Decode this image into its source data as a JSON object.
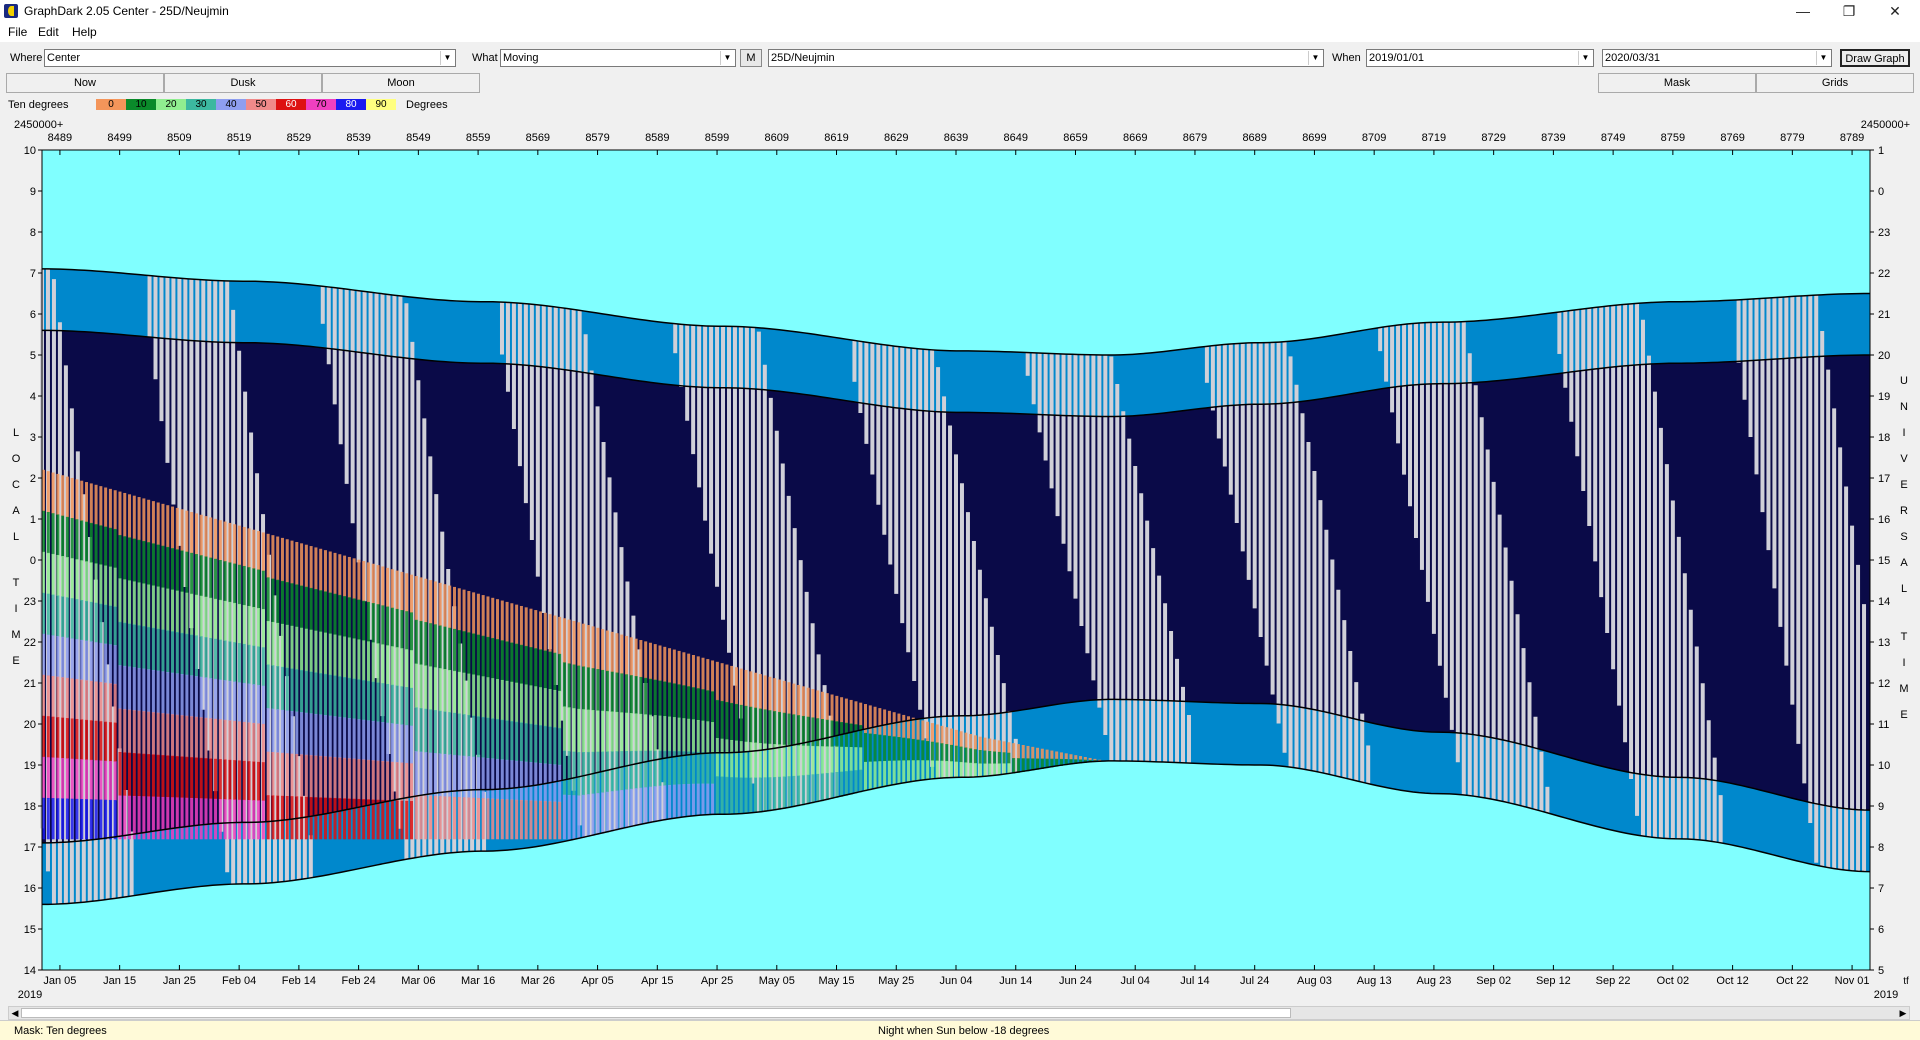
{
  "window": {
    "title": "GraphDark 2.05 Center  - 25D/Neujmin"
  },
  "menu": [
    "File",
    "Edit",
    "Help"
  ],
  "toolbar": {
    "where_label": "Where",
    "where_value": "Center",
    "what_label": "What",
    "what_value": "Moving",
    "m_button": "M",
    "object_value": "25D/Neujmin",
    "when_label": "When",
    "when_start": "2019/01/01",
    "when_end": "2020/03/31",
    "draw_button": "Draw Graph"
  },
  "tabs": [
    "Now",
    "Dusk",
    "Moon"
  ],
  "right_tabs": [
    "Mask",
    "Grids"
  ],
  "legend": {
    "title": "Ten degrees",
    "unit": "Degrees",
    "entries": [
      {
        "label": "0",
        "color": "#f4955a"
      },
      {
        "label": "10",
        "color": "#0a8a2a"
      },
      {
        "label": "20",
        "color": "#90ee90"
      },
      {
        "label": "30",
        "color": "#3cb8a0"
      },
      {
        "label": "40",
        "color": "#8e9ef0"
      },
      {
        "label": "50",
        "color": "#f08a8a"
      },
      {
        "label": "60",
        "color": "#dd1111"
      },
      {
        "label": "70",
        "color": "#f040c0"
      },
      {
        "label": "80",
        "color": "#1a1af0"
      },
      {
        "label": "90",
        "color": "#ffff80"
      }
    ]
  },
  "chart_data": {
    "type": "area",
    "jd_prefix_top_left": "2450000+",
    "jd_prefix_top_right": "2450000+",
    "jd_ticks": [
      "8489",
      "8499",
      "8509",
      "8519",
      "8529",
      "8539",
      "8549",
      "8559",
      "8569",
      "8579",
      "8589",
      "8599",
      "8609",
      "8619",
      "8629",
      "8639",
      "8649",
      "8659",
      "8669",
      "8679",
      "8689",
      "8699",
      "8709",
      "8719",
      "8729",
      "8739",
      "8749",
      "8759",
      "8769",
      "8779",
      "8789"
    ],
    "date_ticks": [
      "Jan 05",
      "Jan 15",
      "Jan 25",
      "Feb 04",
      "Feb 14",
      "Feb 24",
      "Mar 06",
      "Mar 16",
      "Mar 26",
      "Apr 05",
      "Apr 15",
      "Apr 25",
      "May 05",
      "May 15",
      "May 25",
      "Jun 04",
      "Jun 14",
      "Jun 24",
      "Jul 04",
      "Jul 14",
      "Jul 24",
      "Aug 03",
      "Aug 13",
      "Aug 23",
      "Sep 02",
      "Sep 12",
      "Sep 22",
      "Oct 02",
      "Oct 12",
      "Oct 22",
      "Nov 01"
    ],
    "year_left": "2019",
    "year_right": "2019",
    "left_axis_title": "LOCAL TIME",
    "right_axis_title": "UNIVERSAL TIME",
    "left_ticks": [
      "10",
      "9",
      "8",
      "7",
      "6",
      "5",
      "4",
      "3",
      "2",
      "1",
      "0",
      "23",
      "22",
      "21",
      "20",
      "19",
      "18",
      "17",
      "16",
      "15",
      "14"
    ],
    "right_ticks": [
      "1",
      "0",
      "23",
      "22",
      "21",
      "20",
      "19",
      "18",
      "17",
      "16",
      "15",
      "14",
      "13",
      "12",
      "11",
      "10",
      "9",
      "8",
      "7",
      "6",
      "5"
    ],
    "corner_right": "tf",
    "x_jd_range": [
      8486,
      8792
    ],
    "night_start_local": [
      [
        8486,
        17.1
      ],
      [
        8520,
        17.6
      ],
      [
        8560,
        18.4
      ],
      [
        8600,
        19.3
      ],
      [
        8640,
        20.2
      ],
      [
        8665,
        20.6
      ],
      [
        8690,
        20.5
      ],
      [
        8720,
        19.8
      ],
      [
        8760,
        18.7
      ],
      [
        8792,
        17.9
      ]
    ],
    "night_end_local": [
      [
        8486,
        5.6
      ],
      [
        8520,
        5.3
      ],
      [
        8560,
        4.8
      ],
      [
        8600,
        4.2
      ],
      [
        8640,
        3.6
      ],
      [
        8665,
        3.5
      ],
      [
        8690,
        3.8
      ],
      [
        8720,
        4.3
      ],
      [
        8760,
        4.8
      ],
      [
        8792,
        5.0
      ]
    ],
    "colors": {
      "sky": "#80ffff",
      "twilight": "#0088cc",
      "night": "#0a0a48",
      "moon": "#d0d0d8",
      "object_curve": "#000000"
    }
  },
  "status": {
    "left": "Mask:  Ten degrees",
    "center": "Night when Sun below -18 degrees"
  }
}
